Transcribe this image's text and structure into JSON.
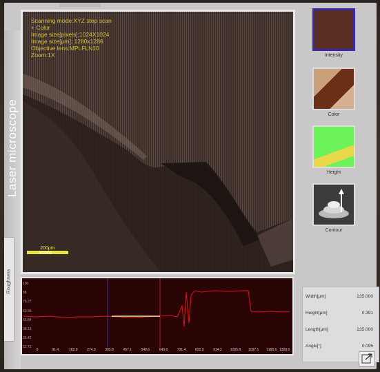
{
  "app": {
    "side_title": "Laser microscope",
    "side_tab": "Roughness"
  },
  "overlay": {
    "lines": [
      "Scanning mode:XYZ step scan",
      "+ Color",
      "Image size[pixels]:1024X1024",
      "Image size[μm]: 1280x1286",
      "Objective lens:MPLFLN10",
      "Zoom:1X"
    ],
    "scale_label": "200μm"
  },
  "modes": [
    {
      "label": "Intensity",
      "icon": "intensity-thumbnail-icon",
      "active": true
    },
    {
      "label": "Color",
      "icon": "color-thumbnail-icon",
      "active": false
    },
    {
      "label": "Height",
      "icon": "height-thumbnail-icon",
      "active": false
    },
    {
      "label": "Contour",
      "icon": "contour-thumbnail-icon",
      "active": false
    }
  ],
  "profile": {
    "y_ticks": [
      "100",
      "88",
      "76.27",
      "63.55",
      "50.84",
      "38.13",
      "25.42",
      "12.71",
      "0"
    ],
    "x_ticks": [
      "0",
      "91.4",
      "182.9",
      "274.3",
      "365.8",
      "457.1",
      "548.6",
      "640.0",
      "731.4",
      "822.9",
      "914.2",
      "1005.8",
      "1097.1",
      "1188.6",
      "1280.0"
    ],
    "line_color": "#e0121e"
  },
  "measurements": [
    {
      "label": "Width[μm]",
      "value": "235.000"
    },
    {
      "label": "Height[μm]",
      "value": "0.391"
    },
    {
      "label": "Length[μm]",
      "value": "235.000"
    },
    {
      "label": "Angle[°]",
      "value": "0.095"
    }
  ],
  "colors": {
    "accent": "#3a2aa8",
    "overlay_text": "#d9c23a",
    "profile_bg": "#2b0505"
  }
}
